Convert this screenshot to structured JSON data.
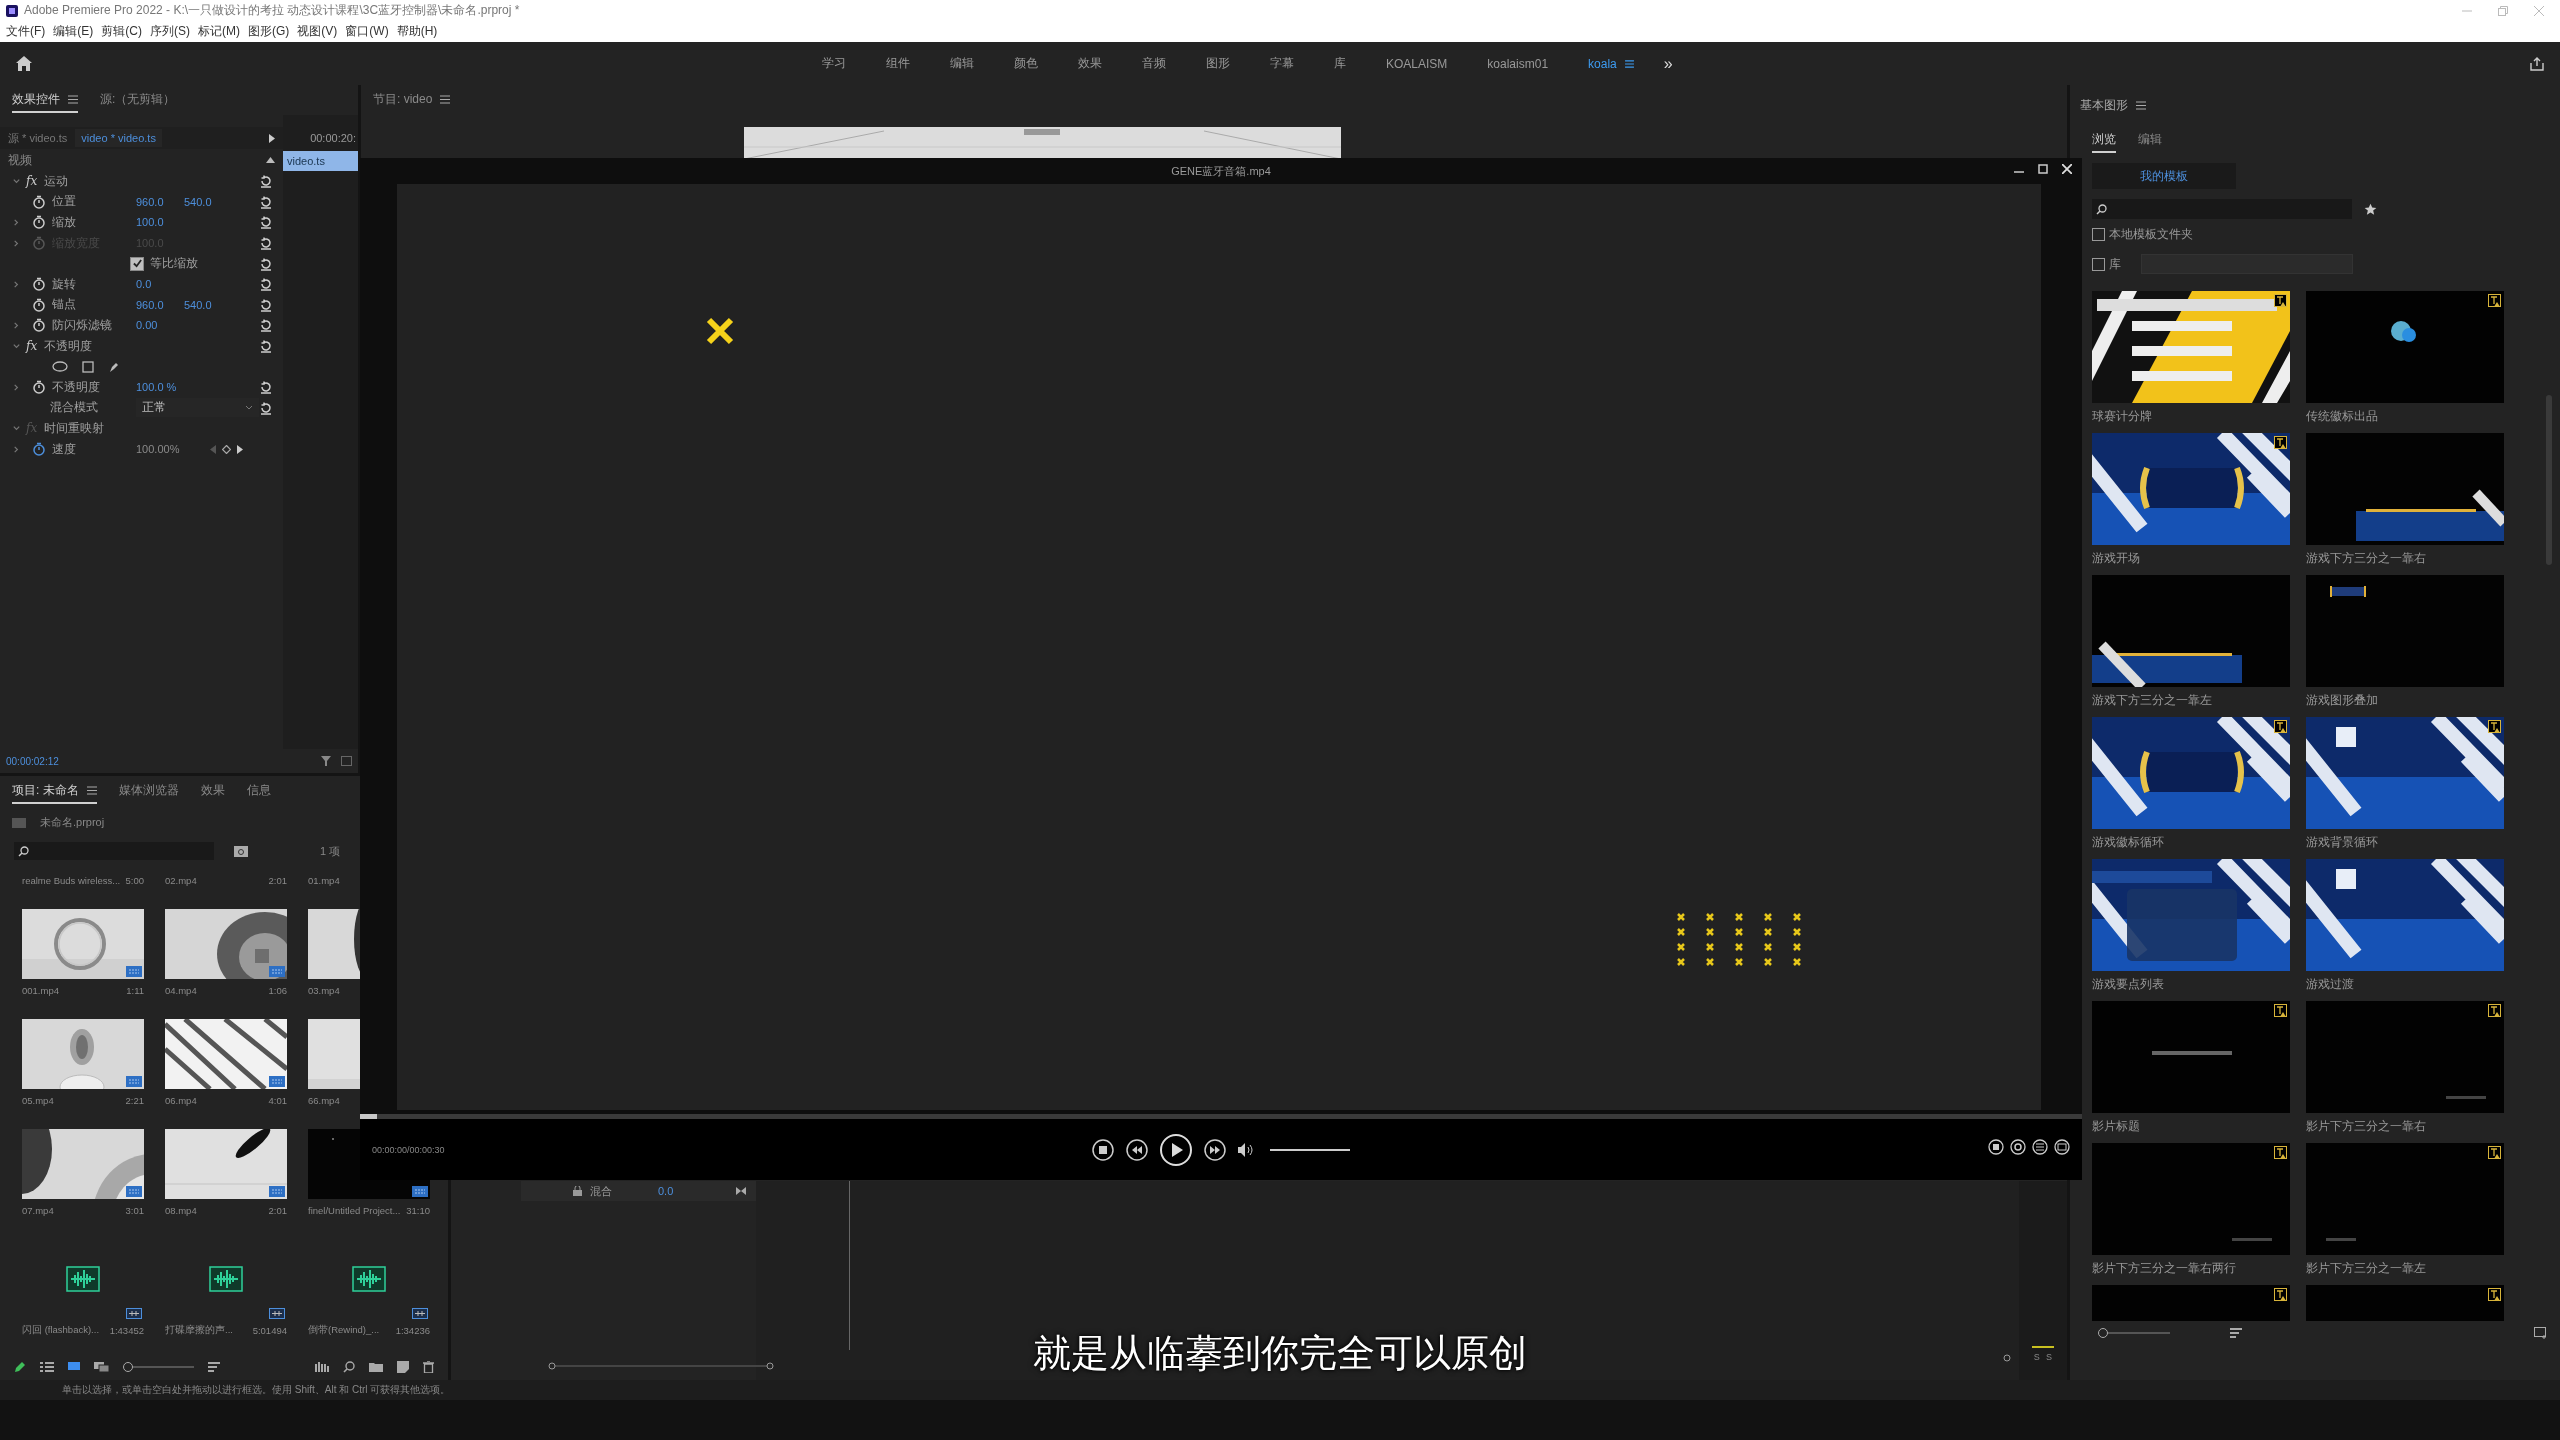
{
  "window": {
    "title": "Adobe Premiere Pro 2022 - K:\\一只做设计的考拉 动态设计课程\\3C蓝牙控制器\\未命名.prproj *"
  },
  "menu": [
    "文件(F)",
    "编辑(E)",
    "剪辑(C)",
    "序列(S)",
    "标记(M)",
    "图形(G)",
    "视图(V)",
    "窗口(W)",
    "帮助(H)"
  ],
  "workspaces": [
    {
      "label": "学习",
      "selected": false
    },
    {
      "label": "组件",
      "selected": false
    },
    {
      "label": "编辑",
      "selected": false
    },
    {
      "label": "颜色",
      "selected": false
    },
    {
      "label": "效果",
      "selected": false
    },
    {
      "label": "音频",
      "selected": false
    },
    {
      "label": "图形",
      "selected": false
    },
    {
      "label": "字幕",
      "selected": false
    },
    {
      "label": "库",
      "selected": false
    },
    {
      "label": "KOALAISM",
      "selected": false
    },
    {
      "label": "koalaism01",
      "selected": false
    },
    {
      "label": "koala",
      "selected": true
    }
  ],
  "workspace_overflow": "»",
  "effect_controls": {
    "tabs": [
      {
        "label": "效果控件",
        "selected": true
      },
      {
        "label": "源:（无剪辑）",
        "selected": false
      }
    ],
    "source": "源 * video.ts",
    "clip": "video * video.ts",
    "timecode": "00:00:20:",
    "clip_bar": "video.ts",
    "section": "视频",
    "current_time": "00:00:02:12",
    "rows": [
      {
        "kind": "effect",
        "fx": "fx",
        "label": "运动",
        "expanded": true,
        "enabled": true,
        "reset": true
      },
      {
        "kind": "property",
        "label": "位置",
        "values": [
          "960.0",
          "540.0"
        ],
        "expandable": false,
        "disabled": false,
        "reset": true
      },
      {
        "kind": "property",
        "label": "缩放",
        "values": [
          "100.0"
        ],
        "expandable": true,
        "disabled": false,
        "reset": true
      },
      {
        "kind": "property",
        "label": "缩放宽度",
        "values": [
          "100.0"
        ],
        "expandable": true,
        "disabled": true,
        "reset": true
      },
      {
        "kind": "checkbox",
        "label": "等比缩放",
        "checked": true,
        "reset": true
      },
      {
        "kind": "property",
        "label": "旋转",
        "values": [
          "0.0"
        ],
        "expandable": true,
        "disabled": false,
        "reset": true
      },
      {
        "kind": "property",
        "label": "锚点",
        "values": [
          "960.0",
          "540.0"
        ],
        "expandable": false,
        "disabled": false,
        "reset": true
      },
      {
        "kind": "property",
        "label": "防闪烁滤镜",
        "values": [
          "0.00"
        ],
        "expandable": true,
        "disabled": false,
        "reset": true
      },
      {
        "kind": "effect",
        "fx": "fx",
        "label": "不透明度",
        "expanded": true,
        "enabled": true,
        "reset": true
      },
      {
        "kind": "masks"
      },
      {
        "kind": "property",
        "label": "不透明度",
        "values": [
          "100.0 %"
        ],
        "expandable": true,
        "disabled": false,
        "reset": true
      },
      {
        "kind": "dropdown",
        "label": "混合模式",
        "value": "正常",
        "reset": true
      },
      {
        "kind": "effect",
        "fx": "fx",
        "label": "时间重映射",
        "expanded": true,
        "enabled": false,
        "reset": false
      },
      {
        "kind": "speed",
        "label": "速度",
        "values": [
          "100.00%"
        ],
        "expandable": true,
        "disabled": false,
        "reset": false
      }
    ]
  },
  "program": {
    "tab": "节目: video"
  },
  "player": {
    "title": "GENE蓝牙音箱.mp4",
    "time": "00:00:00/00:00:30",
    "progress": {
      "level": 0.01
    }
  },
  "project": {
    "tabs": [
      {
        "label": "项目: 未命名",
        "selected": true
      },
      {
        "label": "媒体浏览器",
        "selected": false
      },
      {
        "label": "效果",
        "selected": false
      },
      {
        "label": "信息",
        "selected": false
      }
    ],
    "path": "未命名.prproj",
    "count": "1 项",
    "zoom": {
      "level": 0.05
    },
    "items": [
      {
        "kind": "scrolled",
        "name": "realme Buds wireless...",
        "duration": "5:00"
      },
      {
        "kind": "scrolled",
        "name": "02.mp4",
        "duration": "2:01"
      },
      {
        "kind": "scrolled",
        "name": "01.mp4"
      },
      {
        "kind": "video",
        "name": "001.mp4",
        "duration": "1:11",
        "thumb": {
          "kind": "ring"
        },
        "badge": true
      },
      {
        "kind": "video",
        "name": "04.mp4",
        "duration": "1:06",
        "thumb": {
          "kind": "torus"
        },
        "badge": true
      },
      {
        "kind": "video",
        "name": "03.mp4",
        "thumb": {
          "kind": "edge"
        }
      },
      {
        "kind": "video",
        "name": "05.mp4",
        "duration": "2:21",
        "thumb": {
          "kind": "capsule"
        },
        "badge": true
      },
      {
        "kind": "video",
        "name": "06.mp4",
        "duration": "4:01",
        "thumb": {
          "kind": "stripes"
        },
        "badge": true
      },
      {
        "kind": "video",
        "name": "66.mp4",
        "thumb": {
          "kind": "plain"
        }
      },
      {
        "kind": "video",
        "name": "07.mp4",
        "duration": "3:01",
        "thumb": {
          "kind": "curve"
        },
        "badge": true
      },
      {
        "kind": "video",
        "name": "08.mp4",
        "duration": "2:01",
        "thumb": {
          "kind": "blade"
        },
        "badge": true
      },
      {
        "kind": "video",
        "name": "finel/Untitled Project...",
        "duration": "31:10",
        "thumb": {
          "kind": "dark"
        },
        "badge": true
      },
      {
        "kind": "audio",
        "name": "闪回 (flashback)...",
        "duration": "1:43452"
      },
      {
        "kind": "audio",
        "name": "打碟摩擦的声...",
        "duration": "5:01494"
      },
      {
        "kind": "audio",
        "name": "倒带(Rewind)_...",
        "duration": "1:34236"
      }
    ]
  },
  "timeline": {
    "track": "混合",
    "value": "0.0",
    "meter": [
      "S",
      "S"
    ]
  },
  "graphics": {
    "title": "基本图形",
    "tabs": [
      {
        "label": "浏览",
        "selected": true
      },
      {
        "label": "编辑",
        "selected": false
      }
    ],
    "button": "我的模板",
    "filters": [
      {
        "label": "本地模板文件夹",
        "checked": false
      },
      {
        "label": "库",
        "checked": false
      }
    ],
    "zoom": {
      "level": 0.05
    },
    "templates": [
      {
        "label": "球赛计分牌",
        "thumb": {
          "kind": "scoreboard"
        },
        "badge": true
      },
      {
        "label": "传统徽标出品",
        "thumb": {
          "kind": "logo"
        },
        "badge": true
      },
      {
        "label": "游戏开场",
        "thumb": {
          "kind": "blue-title"
        },
        "badge": true
      },
      {
        "label": "游戏下方三分之一靠右",
        "thumb": {
          "kind": "lower-right"
        },
        "badge": false
      },
      {
        "label": "游戏下方三分之一靠左",
        "thumb": {
          "kind": "lower-left"
        },
        "badge": false
      },
      {
        "label": "游戏图形叠加",
        "thumb": {
          "kind": "corner"
        },
        "badge": false
      },
      {
        "label": "游戏徽标循环",
        "thumb": {
          "kind": "blue-title"
        },
        "badge": true
      },
      {
        "label": "游戏背景循环",
        "thumb": {
          "kind": "blue-stripes"
        },
        "badge": true
      },
      {
        "label": "游戏要点列表",
        "thumb": {
          "kind": "list"
        },
        "badge": false
      },
      {
        "label": "游戏过渡",
        "thumb": {
          "kind": "blue-stripes"
        },
        "badge": false
      },
      {
        "label": "影片标题",
        "thumb": {
          "kind": "black-center"
        },
        "badge": true
      },
      {
        "label": "影片下方三分之一靠右",
        "thumb": {
          "kind": "black-right"
        },
        "badge": true
      },
      {
        "label": "影片下方三分之一靠右两行",
        "thumb": {
          "kind": "black-right"
        },
        "badge": true
      },
      {
        "label": "影片下方三分之一靠左",
        "thumb": {
          "kind": "black-left"
        },
        "badge": true
      },
      {
        "thumb": {
          "kind": "black"
        },
        "badge": true
      },
      {
        "thumb": {
          "kind": "black"
        },
        "badge": true
      }
    ]
  },
  "subtitle": "就是从临摹到你完全可以原创",
  "status": "单击以选择，或单击空白处并拖动以进行框选。使用 Shift、Alt 和 Ctrl 可获得其他选项。"
}
